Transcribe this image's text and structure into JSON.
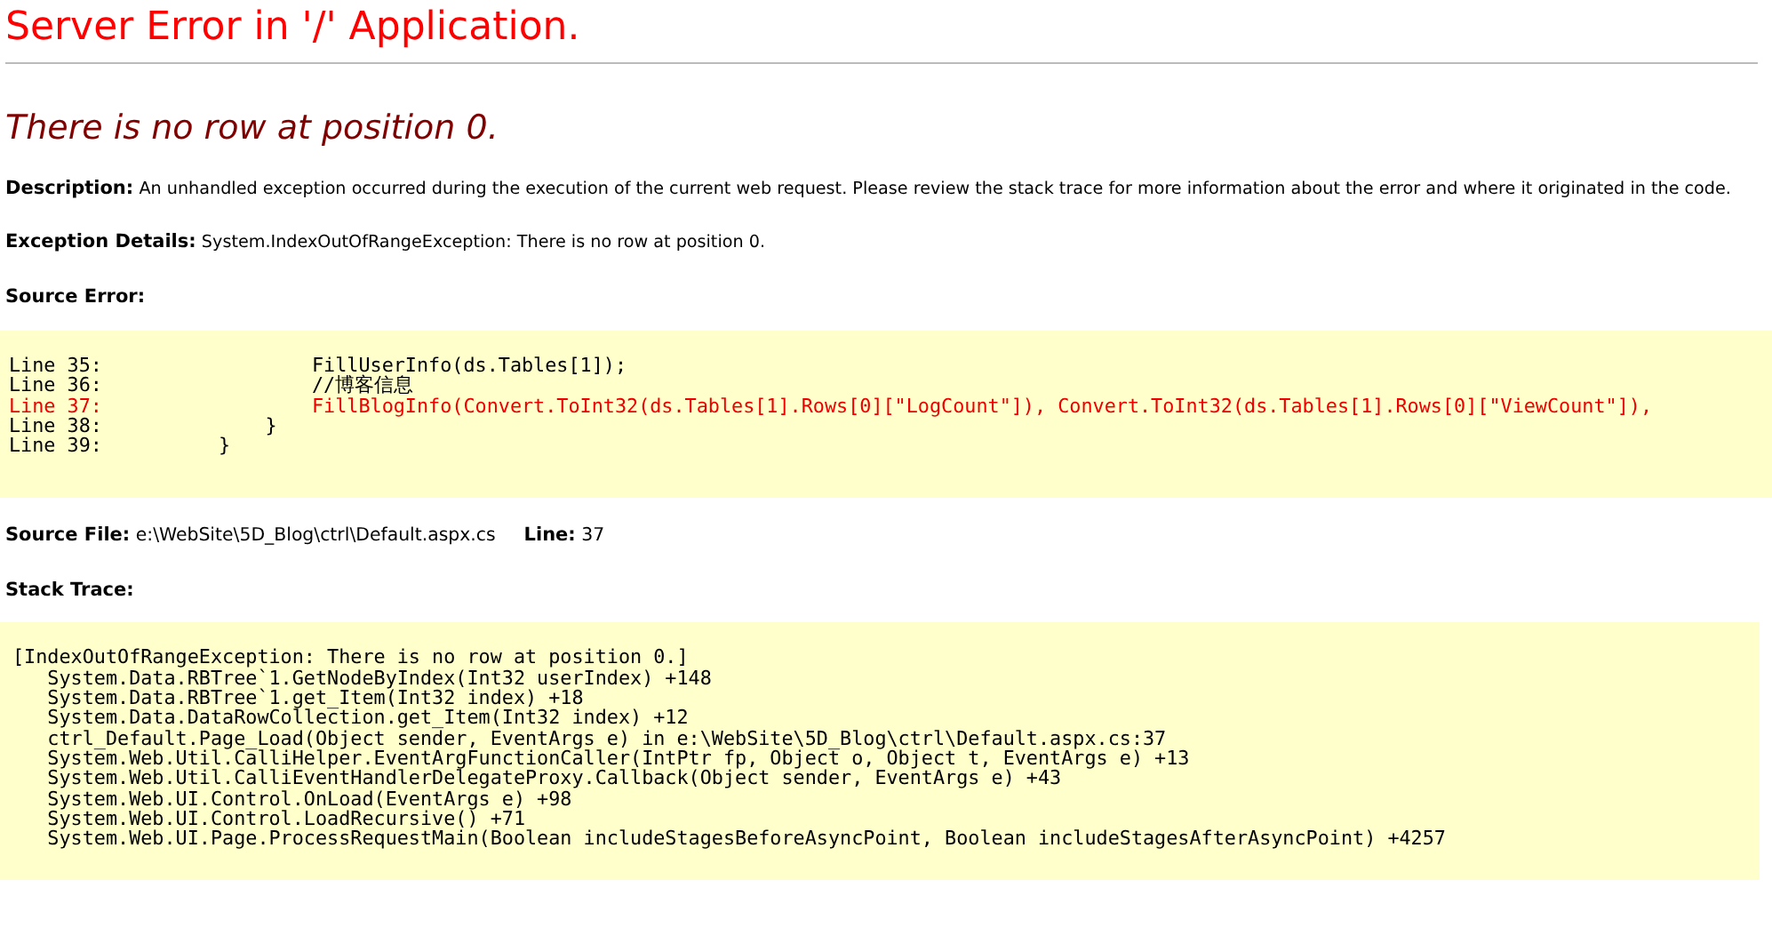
{
  "title": "Server Error in '/' Application.",
  "error_message": "There is no row at position 0.",
  "details": [
    {
      "label": "Description:",
      "text": "An unhandled exception occurred during the execution of the current web request. Please review the stack trace for more information about the error and where it originated in the code."
    },
    {
      "label": "Exception Details:",
      "text": "System.IndexOutOfRangeException: There is no row at position 0."
    }
  ],
  "source_error": {
    "heading": "Source Error:",
    "lines": [
      {
        "text": "Line 35:                  FillUserInfo(ds.Tables[1]);",
        "highlighted": false
      },
      {
        "text": "Line 36:                  //博客信息",
        "highlighted": false
      },
      {
        "text": "Line 37:                  FillBlogInfo(Convert.ToInt32(ds.Tables[1].Rows[0][\"LogCount\"]), Convert.ToInt32(ds.Tables[1].Rows[0][\"ViewCount\"]),",
        "highlighted": true
      },
      {
        "text": "Line 38:              }",
        "highlighted": false
      },
      {
        "text": "Line 39:          }",
        "highlighted": false
      }
    ]
  },
  "source_file": {
    "label": "Source File:",
    "path": "e:\\WebSite\\5D_Blog\\ctrl\\Default.aspx.cs",
    "line_label": "Line:",
    "line": "37"
  },
  "stack_trace": {
    "heading": "Stack Trace:",
    "lines": [
      "[IndexOutOfRangeException: There is no row at position 0.]",
      "   System.Data.RBTree`1.GetNodeByIndex(Int32 userIndex) +148",
      "   System.Data.RBTree`1.get_Item(Int32 index) +18",
      "   System.Data.DataRowCollection.get_Item(Int32 index) +12",
      "   ctrl_Default.Page_Load(Object sender, EventArgs e) in e:\\WebSite\\5D_Blog\\ctrl\\Default.aspx.cs:37",
      "   System.Web.Util.CalliHelper.EventArgFunctionCaller(IntPtr fp, Object o, Object t, EventArgs e) +13",
      "   System.Web.Util.CalliEventHandlerDelegateProxy.Callback(Object sender, EventArgs e) +43",
      "   System.Web.UI.Control.OnLoad(EventArgs e) +98",
      "   System.Web.UI.Control.LoadRecursive() +71",
      "   System.Web.UI.Page.ProcessRequestMain(Boolean includeStagesBeforeAsyncPoint, Boolean includeStagesAfterAsyncPoint) +4257"
    ]
  }
}
